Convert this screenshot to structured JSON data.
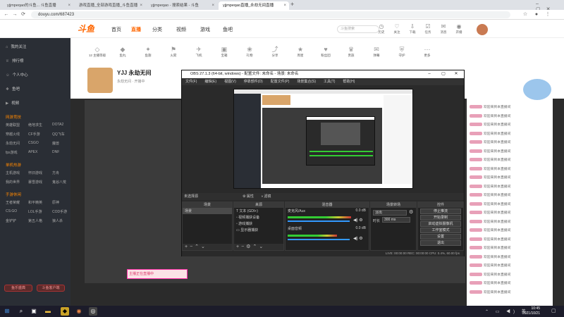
{
  "browser": {
    "tabs": [
      {
        "label": "yjjmpeqao的斗鱼... 斗鱼直播",
        "active": false
      },
      {
        "label": "游戏直播_全部游戏直播_斗鱼直播",
        "active": false
      },
      {
        "label": "yjjmpeqao - 搜索结果 - 斗鱼",
        "active": false
      },
      {
        "label": "yjjmpeqao直播_永劫无间直播",
        "active": true
      }
    ],
    "new_tab": "+",
    "url": "douyu.com/687423"
  },
  "douyu": {
    "logo": "斗鱼",
    "nav": [
      {
        "label": "首页",
        "active": false
      },
      {
        "label": "直播",
        "active": true
      },
      {
        "label": "分类",
        "active": false
      },
      {
        "label": "视频",
        "active": false
      },
      {
        "label": "游戏",
        "active": false
      },
      {
        "label": "鱼吧",
        "active": false
      }
    ],
    "search_placeholder": "斗鱼搜索",
    "header_icons": [
      {
        "icon": "history-icon",
        "label": "历史"
      },
      {
        "icon": "follow-icon",
        "label": "关注"
      },
      {
        "icon": "download-icon",
        "label": "下载"
      },
      {
        "icon": "task-icon",
        "label": "任务"
      },
      {
        "icon": "message-icon",
        "label": "消息"
      },
      {
        "icon": "live-icon",
        "label": "开播"
      }
    ],
    "sidebar": {
      "items": [
        {
          "icon": "home-icon",
          "label": "我的关注"
        },
        {
          "icon": "rank-icon",
          "label": "排行榜"
        },
        {
          "icon": "center-icon",
          "label": "个人中心"
        },
        {
          "icon": "fishbar-icon",
          "label": "鱼吧"
        },
        {
          "icon": "video-icon",
          "label": "视频"
        }
      ],
      "sections": [
        {
          "title": "网游竞技",
          "cells": [
            "英雄联盟",
            "绝地求生",
            "DOTA2",
            "穿越火线",
            "CF手游",
            "QQ飞车",
            "永劫无间",
            "CSGO",
            "魔兽",
            "fps游戏",
            "APEX",
            "DNF"
          ]
        },
        {
          "title": "单机热游",
          "cells": [
            "主机游戏",
            "怀旧游戏",
            "方舟",
            "我的世界",
            "暴雪游戏",
            "鬼谷八荒"
          ]
        },
        {
          "title": "手游休闲",
          "cells": [
            "王者荣耀",
            "和平精英",
            "原神",
            "CS:GO",
            "LOL手游",
            "COD手游",
            "金铲铲",
            "第五人格",
            "狼人杀"
          ]
        }
      ],
      "buttons": [
        "鱼乐盛典",
        "斗鱼客户端"
      ]
    },
    "categories": [
      "12 主播等级",
      "鱼丸",
      "鱼翅",
      "火箭",
      "飞机",
      "宝箱",
      "礼物",
      "分享",
      "周星",
      "粉丝团",
      "贵族",
      "弹幕",
      "守护",
      "更多"
    ],
    "room": {
      "streamer": "YJJ 永劫无间",
      "subtitle": "永劫无间 · 开播中"
    },
    "chat_lines": [
      {
        "user": "",
        "text": "欢迎来到本直播间"
      },
      {
        "user": "",
        "text": "欢迎来到本直播间"
      },
      {
        "user": "",
        "text": "欢迎来到本直播间"
      },
      {
        "user": "",
        "text": "欢迎来到本直播间"
      },
      {
        "user": "",
        "text": "欢迎来到本直播间"
      },
      {
        "user": "",
        "text": "欢迎来到本直播间"
      },
      {
        "user": "",
        "text": "欢迎来到本直播间"
      },
      {
        "user": "",
        "text": "欢迎来到本直播间"
      },
      {
        "user": "",
        "text": "欢迎来到本直播间"
      },
      {
        "user": "",
        "text": "欢迎来到本直播间"
      },
      {
        "user": "",
        "text": "欢迎来到本直播间"
      },
      {
        "user": "",
        "text": "欢迎来到本直播间"
      },
      {
        "user": "",
        "text": "欢迎来到本直播间"
      },
      {
        "user": "",
        "text": "欢迎来到本直播间"
      },
      {
        "user": "",
        "text": "欢迎来到本直播间"
      },
      {
        "user": "",
        "text": "欢迎来到本直播间"
      },
      {
        "user": "",
        "text": "欢迎来到本直播间"
      },
      {
        "user": "",
        "text": "欢迎来到本直播间"
      },
      {
        "user": "",
        "text": "欢迎来到本直播间"
      },
      {
        "user": "",
        "text": "欢迎来到本直播间"
      },
      {
        "user": "",
        "text": "欢迎来到本直播间"
      },
      {
        "user": "",
        "text": "欢迎来到本直播间"
      }
    ],
    "stream_notice": "主播正在直播中"
  },
  "obs": {
    "title": "OBS 27.1.3 (64-bit, windows) - 配置文件: 未命名 - 场景: 未命名",
    "menu": [
      "文件(F)",
      "编辑(E)",
      "视图(V)",
      "停靠部件(D)",
      "配置文件(P)",
      "场景集合(S)",
      "工具(T)",
      "帮助(H)"
    ],
    "scene_bar": {
      "label": "未选择源",
      "props": "属性",
      "filters": "滤镜"
    },
    "docks": {
      "scenes": {
        "title": "场景",
        "items": [
          "场景"
        ]
      },
      "sources": {
        "title": "来源",
        "items": [
          "文本 (GDI+)",
          "视频捕获设备",
          "游戏捕获",
          "显示器捕获"
        ]
      },
      "mixer": {
        "title": "混音器",
        "tracks": [
          {
            "name": "桌面音频",
            "db": "0.0 dB"
          },
          {
            "name": "麦克风/Aux",
            "db": "0.0 dB"
          }
        ]
      },
      "transitions": {
        "title": "场景转场",
        "type": "淡出",
        "duration_label": "时长",
        "duration": "300 ms"
      },
      "controls": {
        "title": "控件",
        "buttons": [
          "停止推流",
          "开始录制",
          "启动虚拟摄像机",
          "工作室模式",
          "设置",
          "退出"
        ]
      }
    },
    "status": "LIVE: 00:00:00   REC: 00:00:00   CPU: 0.4%, 60.00 fps"
  },
  "taskbar": {
    "time": "10:45",
    "date": "2021/10/21"
  },
  "colors": {
    "douyu_orange": "#ff6600",
    "obs_bg": "#2a2a2a",
    "sidebar_bg": "#2a2e35",
    "accent_live": "#33cc33"
  }
}
